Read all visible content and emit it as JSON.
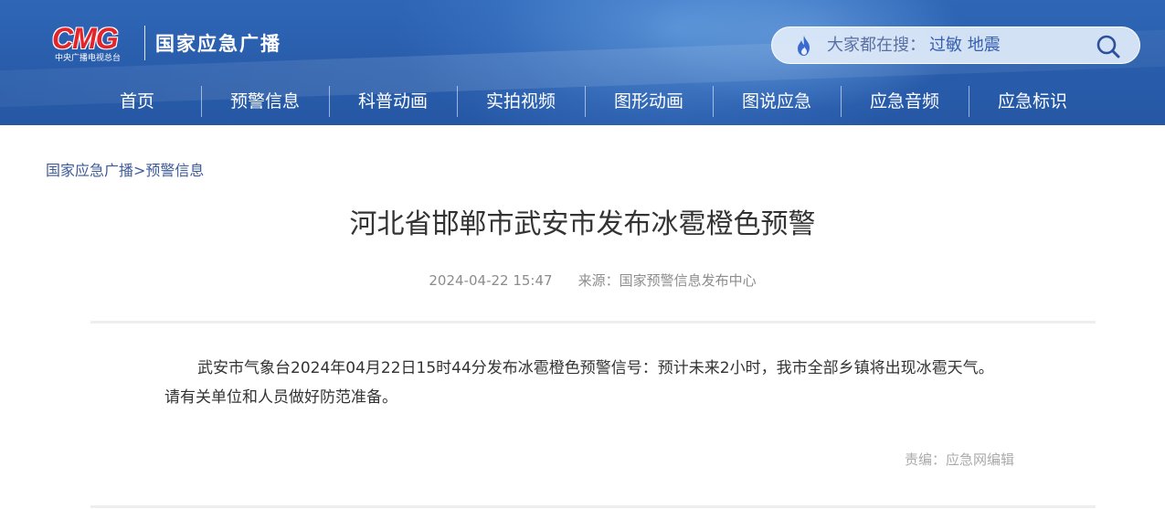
{
  "header": {
    "logo_text": "CMG",
    "logo_subtitle": "中央广播电视总台",
    "brand": "国家应急广播",
    "search": {
      "hint": "大家都在搜：",
      "keywords": "过敏 地震",
      "icon": "magnifier-icon",
      "hot_icon": "fire-icon"
    },
    "nav": [
      {
        "label": "首页"
      },
      {
        "label": "预警信息"
      },
      {
        "label": "科普动画"
      },
      {
        "label": "实拍视频"
      },
      {
        "label": "图形动画"
      },
      {
        "label": "图说应急"
      },
      {
        "label": "应急音频"
      },
      {
        "label": "应急标识"
      }
    ]
  },
  "breadcrumb": {
    "home": "国家应急广播",
    "separator": ">",
    "current": "预警信息"
  },
  "article": {
    "title": "河北省邯郸市武安市发布冰雹橙色预警",
    "datetime": "2024-04-22 15:47",
    "source_label": "来源：",
    "source": "国家预警信息发布中心",
    "body": "武安市气象台2024年04月22日15时44分发布冰雹橙色预警信号：预计未来2小时，我市全部乡镇将出现冰雹天气。请有关单位和人员做好防范准备。",
    "editor_label": "责编：",
    "editor": "应急网编辑"
  },
  "colors": {
    "header_blue": "#2a5fae",
    "logo_red": "#e3242b",
    "breadcrumb_blue": "#3d5a99"
  }
}
